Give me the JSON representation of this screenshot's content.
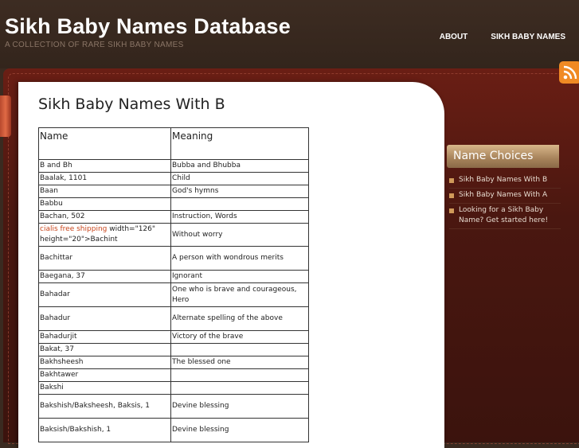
{
  "header": {
    "title": "Sikh Baby Names Database",
    "tagline": "A COLLECTION OF RARE SIKH BABY NAMES",
    "nav": [
      "ABOUT",
      "SIKH BABY NAMES"
    ]
  },
  "post": {
    "title": "Sikh Baby Names With B",
    "columns": [
      "Name",
      "Meaning"
    ],
    "rows": [
      {
        "name": "B and Bh",
        "meaning": "Bubba and Bhubba"
      },
      {
        "name": "Baalak, 1101",
        "meaning": "Child"
      },
      {
        "name": "Baan",
        "meaning": "God's hymns"
      },
      {
        "name": "Babbu",
        "meaning": ""
      },
      {
        "name": "Bachan, 502",
        "meaning": "Instruction, Words"
      },
      {
        "name_link": "cialis free shipping",
        "name_rest": " width=\"126\" height=\"20\">Bachint",
        "meaning": "Without worry"
      },
      {
        "name": "Bachittar",
        "meaning": "A person with wondrous merits"
      },
      {
        "name": "Baegana, 37",
        "meaning": "Ignorant"
      },
      {
        "name": "Bahadar",
        "meaning": "One who is brave and courageous, Hero"
      },
      {
        "name": "Bahadur",
        "meaning": "Alternate spelling of the above"
      },
      {
        "name": "Bahadurjit",
        "meaning": "Victory of the brave"
      },
      {
        "name": "Bakat, 37",
        "meaning": ""
      },
      {
        "name": "Bakhsheesh",
        "meaning": "The blessed one"
      },
      {
        "name": "Bakhtawer",
        "meaning": ""
      },
      {
        "name": "Bakshi",
        "meaning": ""
      },
      {
        "name": "Bakshish/Baksheesh, Baksis, 1",
        "meaning": "Devine blessing"
      },
      {
        "name": "Baksish/Bakshish, 1",
        "meaning": "Devine blessing"
      }
    ]
  },
  "sidebar": {
    "heading": "Name Choices",
    "items": [
      "Sikh Baby Names With B",
      "Sikh Baby Names With A",
      "Looking for a Sikh Baby Name? Get started here!"
    ]
  },
  "icons": {
    "rss": "rss-feed-icon"
  },
  "colors": {
    "link": "#c8451c",
    "rss": "#f08a24"
  }
}
